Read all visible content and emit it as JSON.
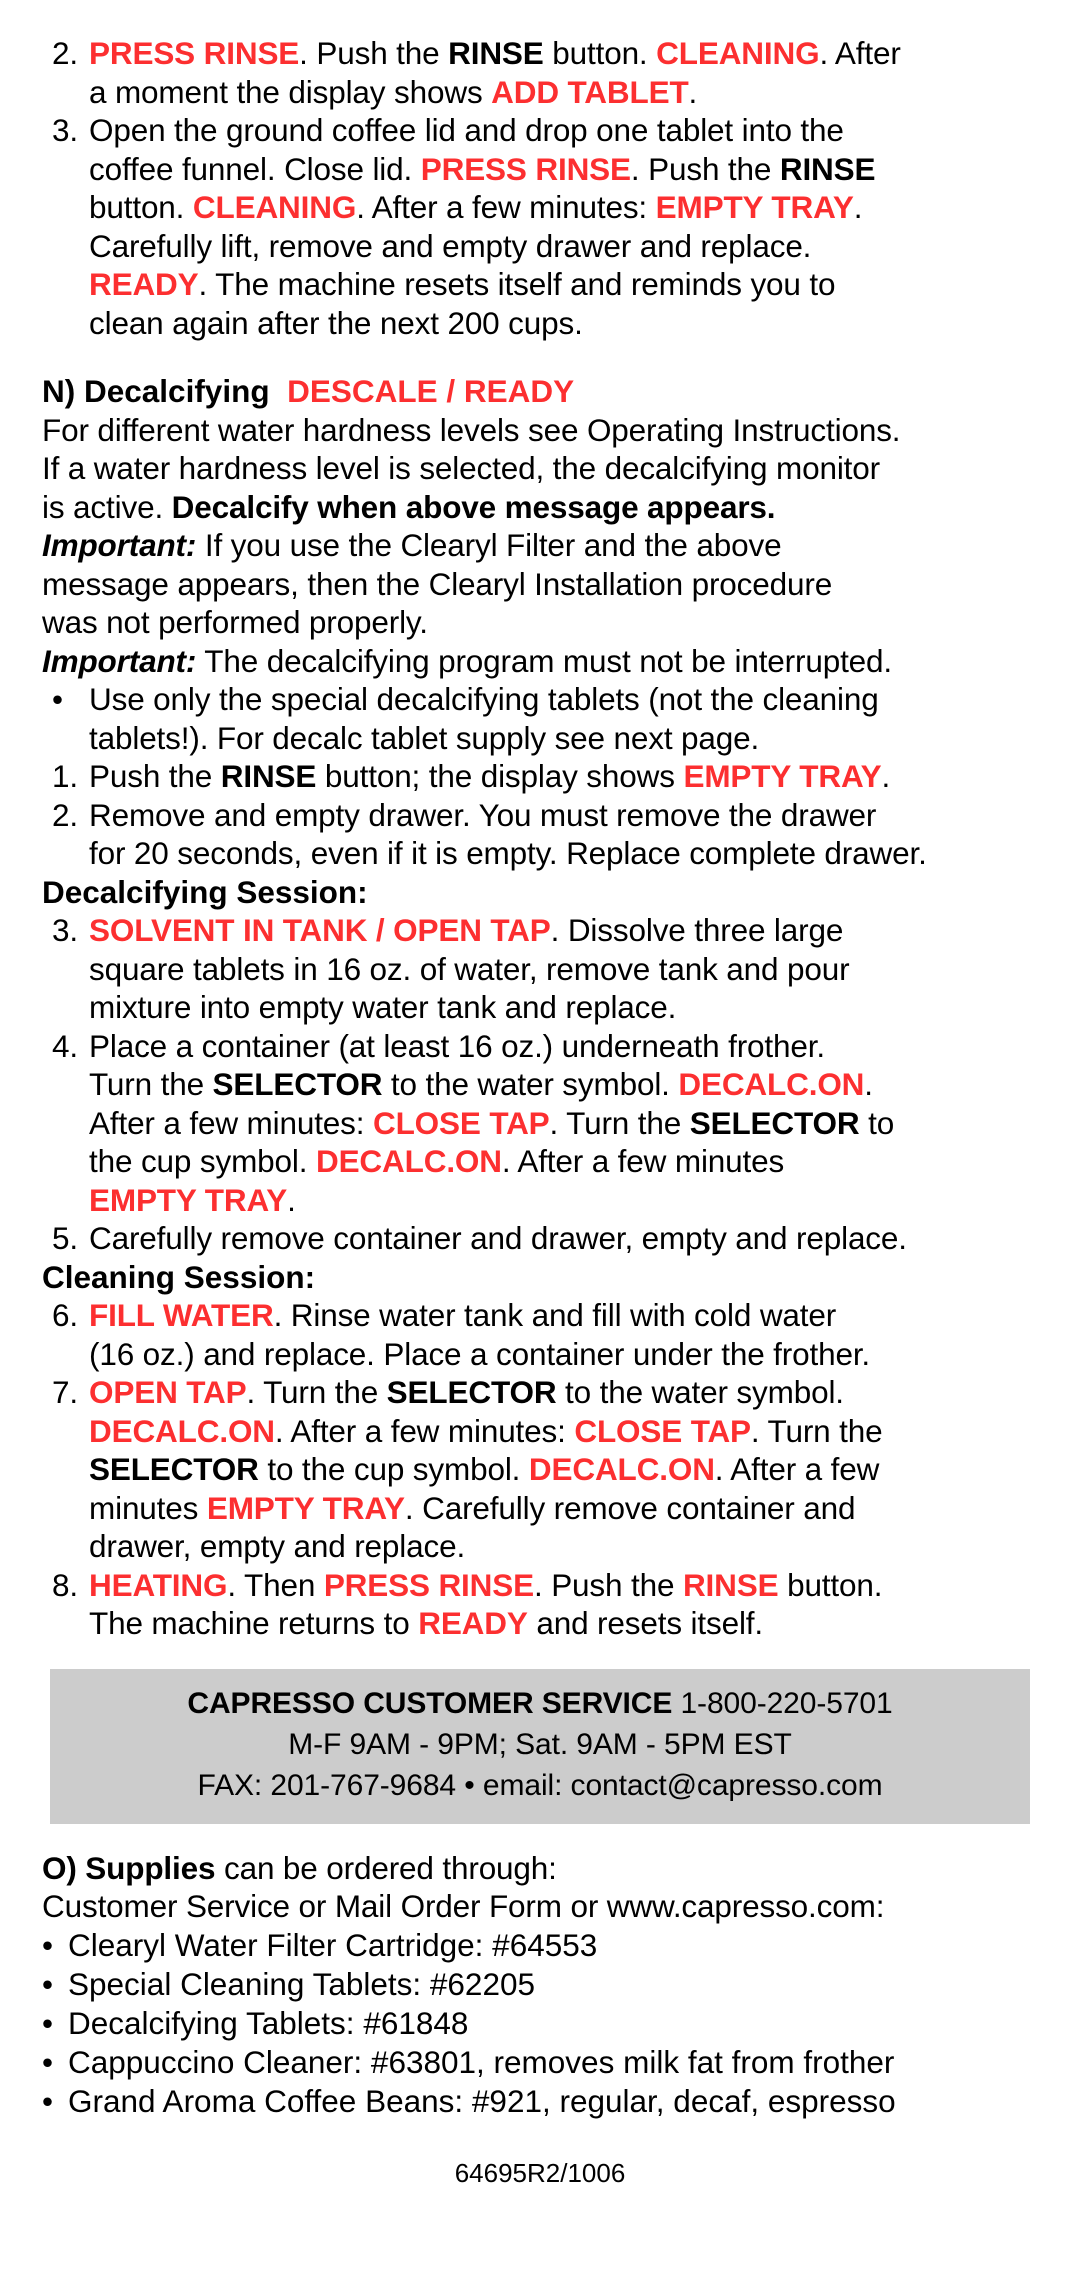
{
  "colors": {
    "display_red": "#fc2f30",
    "service_box_bg": "#cccccc",
    "text": "#000000"
  },
  "cleaning_steps": {
    "step2": {
      "marker": "2.",
      "p1_red": "PRESS RINSE",
      "p2": ". Push the ",
      "p3_bold": "RINSE",
      "p4": " button. ",
      "p5_red": "CLEANING",
      "p6": ". After",
      "l2_a": "a moment  the display shows ",
      "l2_red": "ADD TABLET",
      "l2_b": "."
    },
    "step3": {
      "marker": "3.",
      "l1": "Open the ground coffee lid and drop one tablet into the",
      "l2_a": "coffee funnel. Close lid.  ",
      "l2_red": "PRESS RINSE",
      "l2_b": ". Push the ",
      "l2_bold": "RINSE",
      "l3_a": "button. ",
      "l3_red1": "CLEANING",
      "l3_b": ". After a few minutes: ",
      "l3_red2": "EMPTY TRAY",
      "l3_c": ".",
      "l4": "Carefully lift, remove and empty drawer and replace.",
      "l5_red": "READY",
      "l5_a": ". The machine resets itself and reminds you to",
      "l6": "clean again after the next 200 cups."
    }
  },
  "section_n": {
    "heading_bold": "N) Decalcifying",
    "heading_red": "DESCALE / READY",
    "para1_l1": "For different water hardness levels see Operating Instructions.",
    "para1_l2": "If a water hardness level is selected, the decalcifying monitor",
    "para1_l3_a": "is active. ",
    "para1_l3_bold": "Decalcify when above message appears.",
    "important1_label": "Important:",
    "important1_l1": " If you use the Clearyl Filter and the above",
    "important1_l2": "message appears, then the Clearyl Installation procedure",
    "important1_l3": "was not performed properly.",
    "important2_label": "Important:",
    "important2_text": " The decalcifying program must not be interrupted.",
    "bullet1_marker": "•",
    "bullet1_l1": "Use only the special decalcifying tablets (not the cleaning",
    "bullet1_l2": "tablets!). For decalc tablet supply see next page.",
    "step1": {
      "marker": "1.",
      "a": "Push the ",
      "bold": "RINSE",
      "b": " button; the display shows ",
      "red": "EMPTY TRAY",
      "c": "."
    },
    "step2": {
      "marker": "2.",
      "l1": "Remove and empty drawer. You must remove the drawer",
      "l2": "for 20 seconds, even if it is empty. Replace complete drawer."
    },
    "decalc_session_heading": "Decalcifying Session:",
    "step3": {
      "marker": "3.",
      "red": "SOLVENT IN TANK / OPEN TAP",
      "a": ". Dissolve three large",
      "l2": "square tablets in 16 oz. of water, remove tank and pour",
      "l3": "mixture into empty water tank and replace."
    },
    "step4": {
      "marker": "4.",
      "l1": "Place a container (at least 16 oz.) underneath frother.",
      "l2_a": "Turn the ",
      "l2_bold": "SELECTOR",
      "l2_b": " to the water symbol. ",
      "l2_red": "DECALC.ON",
      "l2_c": ".",
      "l3_a": "After a few minutes: ",
      "l3_red": "CLOSE TAP",
      "l3_b": ". Turn the ",
      "l3_bold": "SELECTOR",
      "l3_c": " to",
      "l4_a": "the cup symbol. ",
      "l4_red": "DECALC.ON",
      "l4_b": ". After a few minutes",
      "l5_red": "EMPTY TRAY",
      "l5_a": "."
    },
    "step5": {
      "marker": "5.",
      "text": "Carefully remove container and drawer, empty and replace."
    },
    "cleaning_session_heading": "Cleaning Session:",
    "step6": {
      "marker": "6.",
      "red": "FILL WATER",
      "a": ". Rinse water tank and fill with cold water",
      "l2": "(16 oz.) and replace. Place a container under the frother."
    },
    "step7": {
      "marker": "7.",
      "red": "OPEN TAP",
      "a": ". Turn the ",
      "bold": "SELECTOR",
      "b": " to the water symbol.",
      "l2_red1": "DECALC.ON",
      "l2_a": ".  After a few minutes: ",
      "l2_red2": "CLOSE TAP",
      "l2_b": ". Turn the",
      "l3_bold": "SELECTOR",
      "l3_a": " to  the cup symbol. ",
      "l3_red": "DECALC.ON",
      "l3_b": ". After a few",
      "l4_a": "minutes ",
      "l4_red": "EMPTY TRAY",
      "l4_b": ". Carefully remove container and",
      "l5": "drawer, empty and replace."
    },
    "step8": {
      "marker": "8.",
      "red1": "HEATING",
      "a": ". Then ",
      "red2": "PRESS RINSE",
      "b": ". Push the ",
      "red3": "RINSE",
      "c": " button.",
      "l2_a": "The machine returns to ",
      "l2_red": "READY",
      "l2_b": " and resets itself."
    }
  },
  "customer_service": {
    "title_bold": "CAPRESSO CUSTOMER  SERVICE",
    "phone": " 1-800-220-5701",
    "hours": "M-F 9AM - 9PM;  Sat. 9AM - 5PM EST",
    "fax_email": "FAX: 201-767-9684 • email: contact@capresso.com"
  },
  "section_o": {
    "heading_bold": "O) Supplies",
    "heading_rest": " can be ordered through:",
    "line2": "Customer Service or Mail Order Form or www.capresso.com:",
    "bullet_char": "•",
    "items": [
      "Clearyl Water Filter Cartridge: #64553",
      "Special Cleaning Tablets: #62205",
      "Decalcifying Tablets: #61848",
      "Cappuccino Cleaner: #63801, removes milk fat from frother",
      "Grand Aroma Coffee Beans: #921, regular, decaf, espresso"
    ]
  },
  "footer": {
    "code": "64695R2/1006"
  }
}
